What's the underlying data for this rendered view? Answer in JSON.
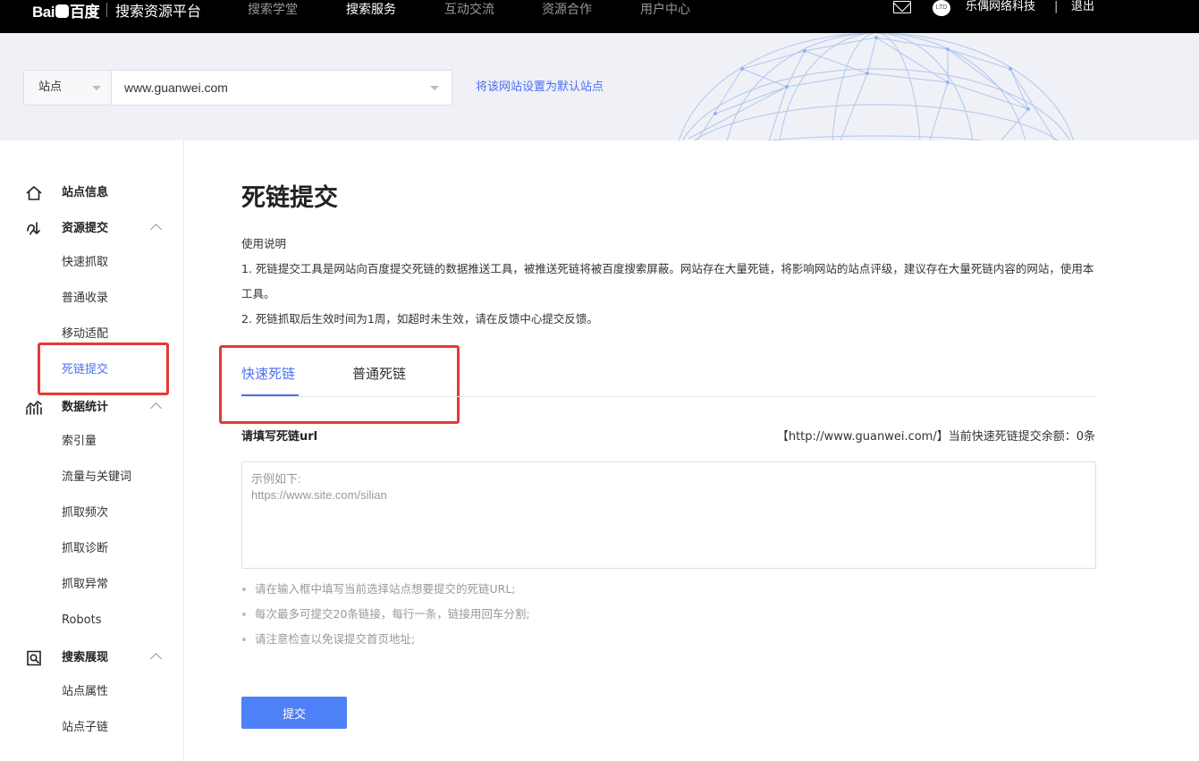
{
  "header": {
    "logo_text": "Bai百度",
    "platform_title": "搜索资源平台",
    "nav": [
      {
        "label": "搜索学堂"
      },
      {
        "label": "搜索服务"
      },
      {
        "label": "互动交流"
      },
      {
        "label": "资源合作"
      },
      {
        "label": "用户中心"
      }
    ],
    "avatar_text": "LTD",
    "user_name": "乐偶网络科技",
    "separator": "|",
    "logout": "退出"
  },
  "site_bar": {
    "type_label": "站点",
    "site_url": "www.guanwei.com",
    "default_link": "将该网站设置为默认站点"
  },
  "sidebar": {
    "groups": [
      {
        "label": "站点信息",
        "icon": "home-icon"
      },
      {
        "label": "资源提交",
        "icon": "submit-icon",
        "items": [
          {
            "label": "快速抓取"
          },
          {
            "label": "普通收录"
          },
          {
            "label": "移动适配"
          },
          {
            "label": "死链提交",
            "active": true
          }
        ]
      },
      {
        "label": "数据统计",
        "icon": "chart-icon",
        "items": [
          {
            "label": "索引量"
          },
          {
            "label": "流量与关键词"
          },
          {
            "label": "抓取频次"
          },
          {
            "label": "抓取诊断"
          },
          {
            "label": "抓取异常"
          },
          {
            "label": "Robots"
          }
        ]
      },
      {
        "label": "搜索展现",
        "icon": "search-display-icon",
        "items": [
          {
            "label": "站点属性"
          },
          {
            "label": "站点子链"
          }
        ]
      }
    ]
  },
  "main": {
    "title": "死链提交",
    "instructions": {
      "heading": "使用说明",
      "line1": "1. 死链提交工具是网站向百度提交死链的数据推送工具，被推送死链将被百度搜索屏蔽。网站存在大量死链，将影响网站的站点评级，建议存在大量死链内容的网站，使用本工具。",
      "line2": "2. 死链抓取后生效时间为1周，如超时未生效，请在反馈中心提交反馈。"
    },
    "tabs": [
      {
        "label": "快速死链",
        "active": true
      },
      {
        "label": "普通死链"
      }
    ],
    "field_label": "请填写死链url",
    "quota_text": "【http://www.guanwei.com/】当前快速死链提交余额：0条",
    "textarea_placeholder": "示例如下:\nhttps://www.site.com/silian",
    "tips": [
      "请在输入框中填写当前选择站点想要提交的死链URL;",
      "每次最多可提交20条链接，每行一条，链接用回车分割;",
      "请注意检查以免误提交首页地址;"
    ],
    "submit_label": "提交"
  },
  "colors": {
    "accent": "#4e6ef2",
    "button": "#4e80f7",
    "highlight_box": "#e53935",
    "topbar": "#000000",
    "sitebar_bg": "#eff1f6"
  }
}
